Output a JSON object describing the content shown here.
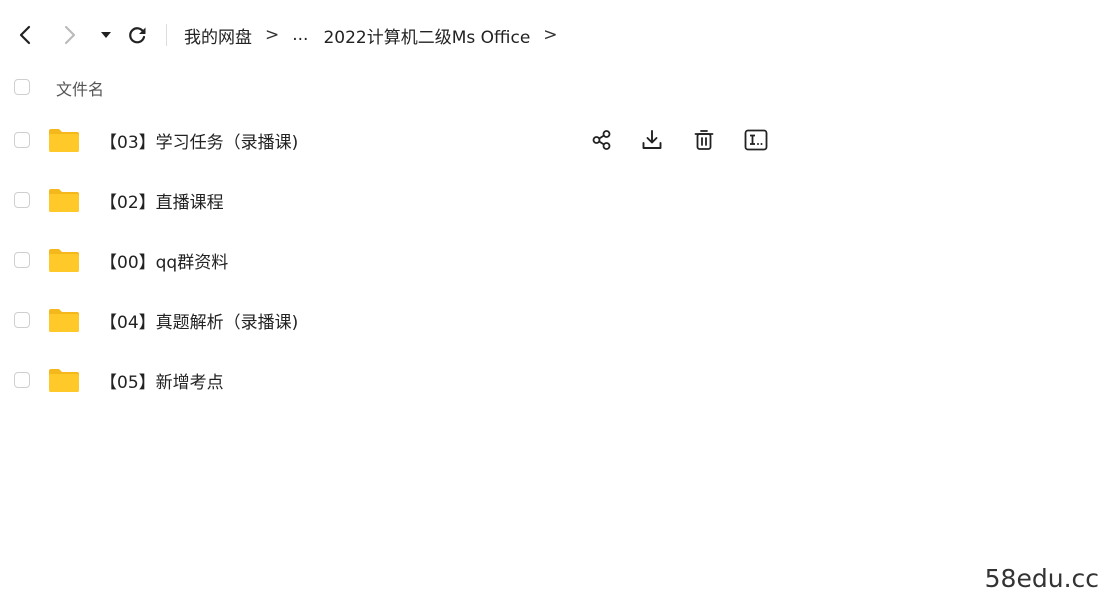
{
  "toolbar": {
    "back_icon": "chevron-left-icon",
    "forward_icon": "chevron-right-icon",
    "history_icon": "caret-down-icon",
    "refresh_icon": "refresh-icon"
  },
  "breadcrumb": {
    "root": "我的网盘",
    "separator": ">",
    "ellipsis": "...",
    "current": "2022计算机二级Ms Office",
    "trailing_separator": ">"
  },
  "list_header": {
    "name_label": "文件名"
  },
  "files": [
    {
      "name": "【03】学习任务（录播课)",
      "type": "folder",
      "hovered": true
    },
    {
      "name": "【02】直播课程",
      "type": "folder"
    },
    {
      "name": "【00】qq群资料",
      "type": "folder"
    },
    {
      "name": "【04】真题解析（录播课)",
      "type": "folder"
    },
    {
      "name": "【05】新增考点",
      "type": "folder"
    }
  ],
  "row_actions": [
    "share-icon",
    "download-icon",
    "delete-icon",
    "rename-icon"
  ],
  "colors": {
    "folder": "#FFC929",
    "folder_tab": "#F5B81C",
    "text": "#222222",
    "checkbox_border": "#CFCFCF"
  },
  "watermark": "58edu.cc"
}
